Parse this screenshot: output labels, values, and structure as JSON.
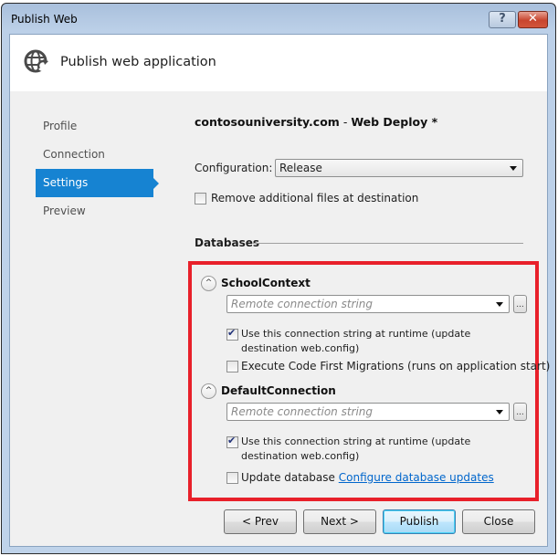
{
  "window": {
    "title": "Publish Web",
    "help_button": "?",
    "close_button": "✕"
  },
  "header": {
    "icon": "globe-publish-icon",
    "title": "Publish web application"
  },
  "nav": {
    "items": [
      {
        "label": "Profile",
        "active": false
      },
      {
        "label": "Connection",
        "active": false
      },
      {
        "label": "Settings",
        "active": true
      },
      {
        "label": "Preview",
        "active": false
      }
    ]
  },
  "settings": {
    "profile_name": "contosouniversity.com",
    "profile_separator": " - ",
    "profile_method": "Web Deploy *",
    "configuration_label": "Configuration:",
    "configuration_value": "Release",
    "remove_files_label": "Remove additional files at destination",
    "remove_files_checked": false,
    "databases_label": "Databases"
  },
  "databases": [
    {
      "name": "SchoolContext",
      "expander": "^",
      "connection_placeholder": "Remote connection string",
      "browse_label": "...",
      "use_runtime_label": "Use this connection string at runtime (update destination web.config)",
      "use_runtime_checked": true,
      "option_label": "Execute Code First Migrations (runs on application start)",
      "option_checked": false
    },
    {
      "name": "DefaultConnection",
      "expander": "^",
      "connection_placeholder": "Remote connection string",
      "browse_label": "...",
      "use_runtime_label": "Use this connection string at runtime (update destination web.config)",
      "use_runtime_checked": true,
      "option_label": "Update database",
      "option_checked": false,
      "option_link": "Configure database updates"
    }
  ],
  "colors": {
    "accent": "#1683d2",
    "highlight": "#e8202a",
    "link": "#0066cc"
  },
  "buttons": {
    "prev": "< Prev",
    "next": "Next >",
    "publish": "Publish",
    "close": "Close"
  }
}
